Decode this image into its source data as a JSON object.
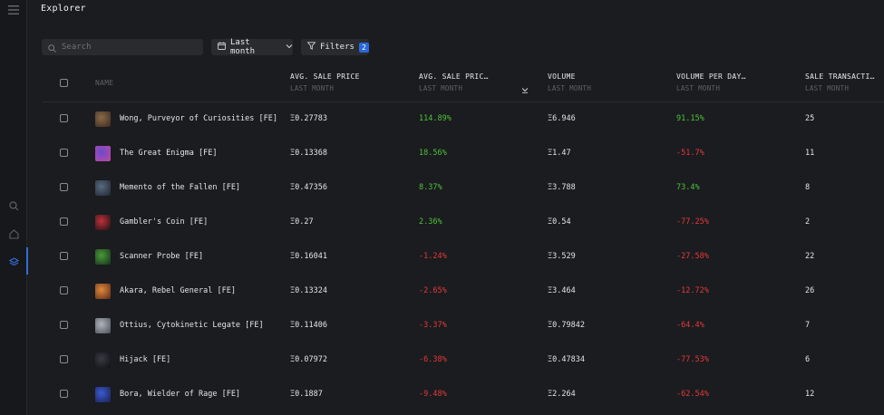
{
  "app": {
    "title": "Explorer"
  },
  "colors": {
    "accent": "#2a67d8",
    "positive": "#4cc23b",
    "negative": "#e5393b"
  },
  "rail": {
    "icons": [
      "menu-icon",
      "search-icon",
      "home-icon",
      "layers-icon"
    ]
  },
  "search": {
    "placeholder": "Search"
  },
  "period": {
    "label": "Last month"
  },
  "filters": {
    "label": "Filters",
    "count": "2"
  },
  "table": {
    "headers": [
      {
        "label": "NAME",
        "sub": ""
      },
      {
        "label": "AVG. SALE PRICE",
        "sub": "LAST MONTH"
      },
      {
        "label": "AVG. SALE PRIC…",
        "sub": "LAST MONTH"
      },
      {
        "label": "VOLUME",
        "sub": "LAST MONTH"
      },
      {
        "label": "VOLUME PER DAY…",
        "sub": "LAST MONTH"
      },
      {
        "label": "SALE TRANSACTI…",
        "sub": "LAST MONTH"
      }
    ],
    "rows": [
      {
        "name": "Wong, Purveyor of Curiosities [FE]",
        "price": "Ξ0.27783",
        "price_change": "114.89%",
        "price_dir": "pos",
        "volume": "Ξ6.946",
        "volume_change": "91.15%",
        "volume_dir": "pos",
        "sales": "25",
        "thumb": [
          "#8a6a4a",
          "#3a2a20"
        ]
      },
      {
        "name": "The Great Enigma [FE]",
        "price": "Ξ0.13368",
        "price_change": "18.56%",
        "price_dir": "pos",
        "volume": "Ξ1.47",
        "volume_change": "-51.7%",
        "volume_dir": "neg",
        "sales": "11",
        "thumb": [
          "#6a4ad0",
          "#c04aa0"
        ]
      },
      {
        "name": "Memento of the Fallen [FE]",
        "price": "Ξ0.47356",
        "price_change": "8.37%",
        "price_dir": "pos",
        "volume": "Ξ3.788",
        "volume_change": "73.4%",
        "volume_dir": "pos",
        "sales": "8",
        "thumb": [
          "#5a6a80",
          "#1f2633"
        ]
      },
      {
        "name": "Gambler's Coin [FE]",
        "price": "Ξ0.27",
        "price_change": "2.36%",
        "price_dir": "pos",
        "volume": "Ξ0.54",
        "volume_change": "-77.25%",
        "volume_dir": "neg",
        "sales": "2",
        "thumb": [
          "#c0303a",
          "#1a1215"
        ]
      },
      {
        "name": "Scanner Probe [FE]",
        "price": "Ξ0.16041",
        "price_change": "-1.24%",
        "price_dir": "neg",
        "volume": "Ξ3.529",
        "volume_change": "-27.58%",
        "volume_dir": "neg",
        "sales": "22",
        "thumb": [
          "#4a9a3a",
          "#14301a"
        ]
      },
      {
        "name": "Akara, Rebel General [FE]",
        "price": "Ξ0.13324",
        "price_change": "-2.65%",
        "price_dir": "neg",
        "volume": "Ξ3.464",
        "volume_change": "-12.72%",
        "volume_dir": "neg",
        "sales": "26",
        "thumb": [
          "#e08a3a",
          "#5a2a1a"
        ]
      },
      {
        "name": "Ottius, Cytokinetic Legate [FE]",
        "price": "Ξ0.11406",
        "price_change": "-3.37%",
        "price_dir": "neg",
        "volume": "Ξ0.79842",
        "volume_change": "-64.4%",
        "volume_dir": "neg",
        "sales": "7",
        "thumb": [
          "#b0b4bc",
          "#4a4e58"
        ]
      },
      {
        "name": "Hijack [FE]",
        "price": "Ξ0.07972",
        "price_change": "-6.38%",
        "price_dir": "neg",
        "volume": "Ξ0.47834",
        "volume_change": "-77.53%",
        "volume_dir": "neg",
        "sales": "6",
        "thumb": [
          "#3a3a44",
          "#101014"
        ]
      },
      {
        "name": "Bora, Wielder of Rage [FE]",
        "price": "Ξ0.1887",
        "price_change": "-9.48%",
        "price_dir": "neg",
        "volume": "Ξ2.264",
        "volume_change": "-62.54%",
        "volume_dir": "neg",
        "sales": "12",
        "thumb": [
          "#3a5ad0",
          "#1a2050"
        ]
      }
    ]
  }
}
